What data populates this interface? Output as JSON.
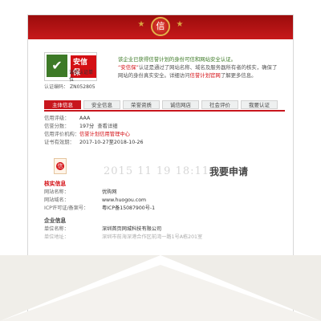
{
  "header": {
    "badge_char": "信"
  },
  "logo": {
    "title": "安信保",
    "subtitle": "诚信认证单位",
    "id_label": "认证编码：",
    "id_value": "ZN052805"
  },
  "intro": {
    "line1": "该企业已获得信誉计划的身份可信和网站安全认证。",
    "line2_a": "“安信保”",
    "line2_b": "认证是通过了网站名称、域名及服务器所有者的核实，确保了",
    "line3_a": "网站的身份真实安全。详细访问",
    "line3_b": "信誉计划官网",
    "line3_c": "了解更多信息。"
  },
  "tabs": [
    {
      "label": "主体信息",
      "active": true
    },
    {
      "label": "安全信息"
    },
    {
      "label": "荣誉资质"
    },
    {
      "label": "诚信网店"
    },
    {
      "label": "社会评价"
    },
    {
      "label": "我要认证"
    }
  ],
  "credit": {
    "level_label": "信用评级：",
    "level_value": "AAA",
    "score_label": "信誉分数：",
    "score_value": "197分",
    "score_link": "查看详细",
    "org_label": "信用评价机构：",
    "org_value": "信誉计划信用管理中心",
    "valid_label": "证书有效期：",
    "valid_value": "2017-10-27至2018-10-26"
  },
  "overlay": {
    "timestamp": "2015  11  19  18:11",
    "apply": "我要申请"
  },
  "verify": {
    "title": "核实信息",
    "name_label": "网站名称：",
    "name_value": "优购网",
    "domain_label": "网站域名：",
    "domain_value": "www.huogou.com",
    "icp_label": "ICP许可证/备案号：",
    "icp_value": "粤ICP备15087900号-1"
  },
  "company": {
    "title": "企业信息",
    "name_label": "单位名称：",
    "name_value": "深圳首页网城科技有限公司",
    "addr_label": "单位地址：",
    "addr_value": "深圳市前海深港合作区前湾一路1号A栋201室"
  }
}
